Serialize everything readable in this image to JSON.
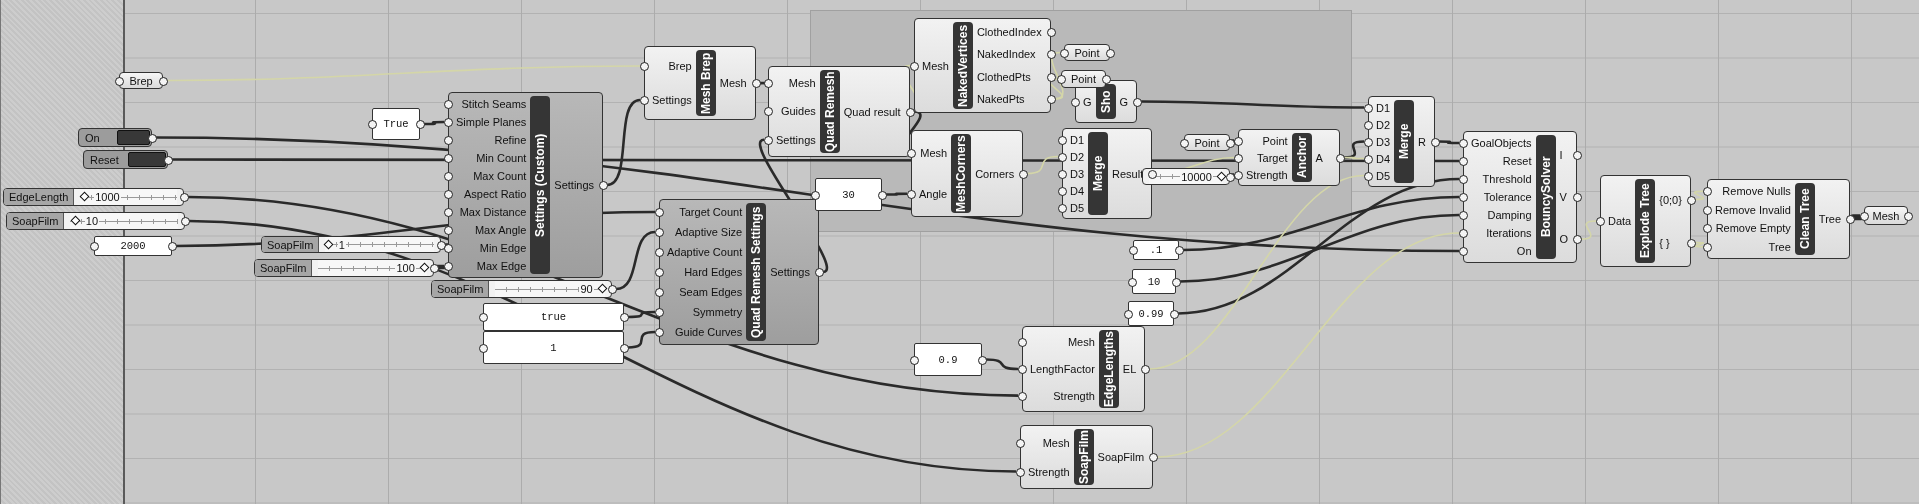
{
  "canvas": {
    "nodes": [
      {
        "kind": "param",
        "label": "Brep"
      },
      {
        "kind": "panel",
        "text": "True"
      },
      {
        "kind": "toggle",
        "label": "On"
      },
      {
        "kind": "toggle",
        "label": "Reset"
      },
      {
        "kind": "slider",
        "label": "EdgeLength",
        "value": "1000",
        "level": 0.04
      },
      {
        "kind": "slider",
        "label": "SoapFilm",
        "value": "10",
        "level": 0.04
      },
      {
        "kind": "panel",
        "text": "2000"
      },
      {
        "kind": "slider",
        "label": "SoapFilm",
        "value": "1",
        "level": 0.02
      },
      {
        "kind": "slider",
        "label": "SoapFilm",
        "value": "100",
        "level": 0.97
      },
      {
        "kind": "slider",
        "label": "SoapFilm",
        "value": "90",
        "level": 0.97
      },
      {
        "kind": "panel",
        "text": "true"
      },
      {
        "kind": "panel",
        "text": "1"
      },
      {
        "kind": "component",
        "name": "Settings (Custom)",
        "dimmed": true,
        "inputs": [
          "Stitch Seams",
          "Simple Planes",
          "Refine",
          "Min Count",
          "Max Count",
          "Aspect Ratio",
          "Max Distance",
          "Max Angle",
          "Min Edge",
          "Max Edge"
        ],
        "outputs": [
          "Settings"
        ]
      },
      {
        "kind": "component",
        "name": "Mesh Brep",
        "dimmed": false,
        "inputs": [
          "Brep",
          "Settings"
        ],
        "outputs": [
          "Mesh"
        ]
      },
      {
        "kind": "component",
        "name": "Quad Remesh",
        "dimmed": false,
        "inputs": [
          "Mesh",
          "Guides",
          "Settings"
        ],
        "outputs": [
          "Quad result"
        ]
      },
      {
        "kind": "component",
        "name": "Quad Remesh Settings",
        "dimmed": true,
        "inputs": [
          "Target Count",
          "Adaptive Size",
          "Adaptive Count",
          "Hard Edges",
          "Seam Edges",
          "Symmetry",
          "Guide Curves"
        ],
        "outputs": [
          "Settings"
        ]
      },
      {
        "kind": "component",
        "name": "NakedVertices",
        "dimmed": false,
        "inputs": [
          "Mesh"
        ],
        "outputs": [
          "ClothedIndex",
          "NakedIndex",
          "ClothedPts",
          "NakedPts"
        ]
      },
      {
        "kind": "panel",
        "text": "30"
      },
      {
        "kind": "component",
        "name": "MeshCorners",
        "dimmed": false,
        "inputs": [
          "Mesh",
          "Angle"
        ],
        "outputs": [
          "Corners"
        ]
      },
      {
        "kind": "param",
        "label": "Point"
      },
      {
        "kind": "component",
        "name": "Sho",
        "dimmed": false,
        "inputs": [
          "G"
        ],
        "outputs": [
          "G"
        ]
      },
      {
        "kind": "param",
        "label": "Point"
      },
      {
        "kind": "component",
        "name": "Merge",
        "dimmed": false,
        "inputs": [
          "D1",
          "D2",
          "D3",
          "D4",
          "D5"
        ],
        "outputs": [
          "Result"
        ]
      },
      {
        "kind": "param",
        "label": "Point"
      },
      {
        "kind": "slider",
        "value": "10000",
        "level": 0.97
      },
      {
        "kind": "component",
        "name": "Anchor",
        "dimmed": false,
        "inputs": [
          "Point",
          "Target",
          "Strength"
        ],
        "outputs": [
          "A"
        ]
      },
      {
        "kind": "panel",
        "text": ".1"
      },
      {
        "kind": "panel",
        "text": "10"
      },
      {
        "kind": "panel",
        "text": "0.99"
      },
      {
        "kind": "panel",
        "text": "0.9"
      },
      {
        "kind": "component",
        "name": "EdgeLengths",
        "dimmed": false,
        "inputs": [
          "Mesh",
          "LengthFactor",
          "Strength"
        ],
        "outputs": [
          "EL"
        ]
      },
      {
        "kind": "component",
        "name": "SoapFilm",
        "dimmed": false,
        "inputs": [
          "Mesh",
          "Strength"
        ],
        "outputs": [
          "SoapFilm"
        ]
      },
      {
        "kind": "component",
        "name": "Merge",
        "dimmed": false,
        "inputs": [
          "D1",
          "D2",
          "D3",
          "D4",
          "D5"
        ],
        "outputs": [
          "R"
        ]
      },
      {
        "kind": "component",
        "name": "BouncySolver",
        "dimmed": false,
        "inputs": [
          "GoalObjects",
          "Reset",
          "Threshold",
          "Tolerance",
          "Damping",
          "Iterations",
          "On"
        ],
        "outputs": [
          "I",
          "V",
          "O"
        ]
      },
      {
        "kind": "component",
        "name": "Explode Tree",
        "dimmed": false,
        "inputs": [
          "Data"
        ],
        "outputs": [
          "{0;0}",
          "{ }"
        ]
      },
      {
        "kind": "component",
        "name": "Clean Tree",
        "dimmed": false,
        "inputs": [
          "Remove Nulls",
          "Remove Invalid",
          "Remove Empty",
          "Tree"
        ],
        "outputs": [
          "Tree"
        ]
      },
      {
        "kind": "param",
        "label": "Mesh"
      }
    ]
  }
}
